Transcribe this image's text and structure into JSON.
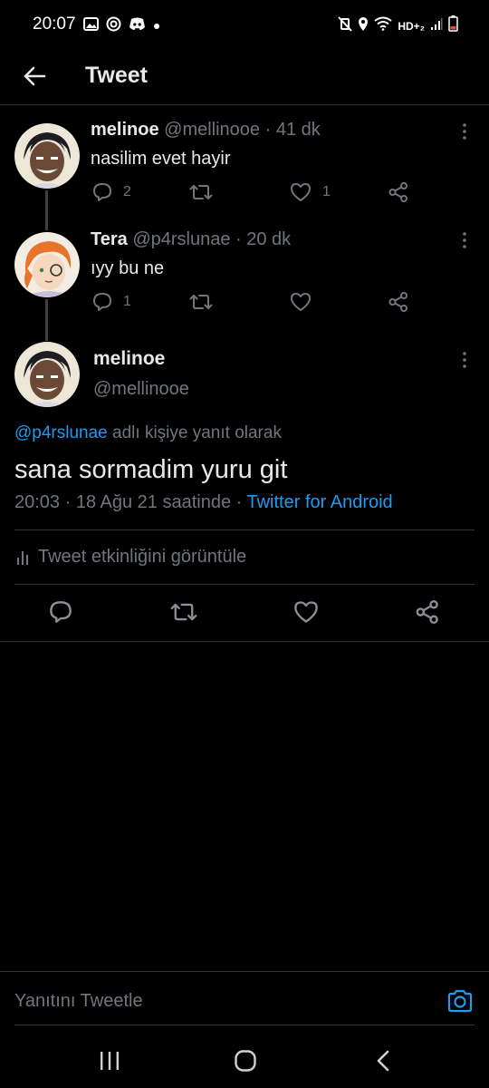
{
  "status_bar": {
    "time": "20:07",
    "network": "HD+₂",
    "left_icons": [
      "gallery-icon",
      "instagram-icon",
      "discord-icon",
      "dot-icon"
    ],
    "right_icons": [
      "mute-vibrate-icon",
      "location-icon",
      "wifi-icon",
      "signal-icon",
      "battery-icon"
    ]
  },
  "header": {
    "title": "Tweet"
  },
  "thread": [
    {
      "name": "melinoe",
      "meta": "@mellinooe · 41 dk",
      "text": "nasilim evet hayir",
      "reply_count": "2",
      "retweet_count": "",
      "like_count": "1"
    },
    {
      "name": "Tera",
      "meta": "@p4rslunae · 20 dk",
      "text": "ıyy bu ne",
      "reply_count": "1",
      "retweet_count": "",
      "like_count": ""
    }
  ],
  "main_tweet": {
    "name": "melinoe",
    "handle": "@mellinooe",
    "reply_mention": "@p4rslunae",
    "reply_suffix": " adlı kişiye yanıt olarak",
    "text": "sana sormadim yuru git",
    "timestamp": "20:03 · 18 Ağu 21 saatinde · ",
    "source": "Twitter for Android",
    "activity_label": "Tweet etkinliğini görüntüle"
  },
  "reply_bar": {
    "placeholder": "Yanıtını Tweetle"
  },
  "colors": {
    "background": "#000000",
    "accent": "#1d9bf0",
    "secondary_text": "#71767b",
    "primary_text": "#e7e9ea",
    "divider": "#2f3336"
  }
}
